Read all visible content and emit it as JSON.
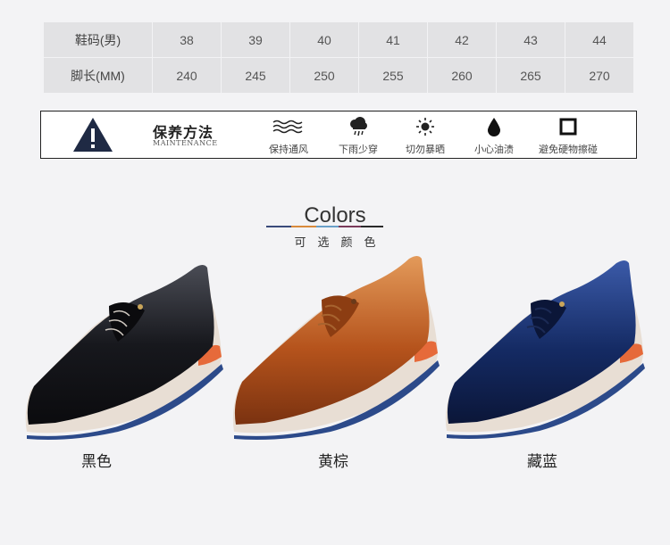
{
  "size_table": {
    "rows": [
      {
        "label": "鞋码(男)",
        "values": [
          "38",
          "39",
          "40",
          "41",
          "42",
          "43",
          "44"
        ]
      },
      {
        "label": "脚长(MM)",
        "values": [
          "240",
          "245",
          "250",
          "255",
          "260",
          "265",
          "270"
        ]
      }
    ]
  },
  "maintenance": {
    "title": "保养方法",
    "subtitle": "MAINTENANCE",
    "items": [
      {
        "icon": "wind-icon",
        "label": "保持通风"
      },
      {
        "icon": "rain-cloud-icon",
        "label": "下雨少穿"
      },
      {
        "icon": "sun-icon",
        "label": "切勿暴晒"
      },
      {
        "icon": "oil-drop-icon",
        "label": "小心油渍"
      },
      {
        "icon": "square-icon",
        "label": "避免硬物擦碰"
      }
    ]
  },
  "colors": {
    "title": "Colors",
    "subtitle": "可选颜色",
    "line_colors": [
      "#3a4a7a",
      "#d88a3c",
      "#6aa0c8",
      "#7a3a5a",
      "#2a2a2a"
    ]
  },
  "shoes": [
    {
      "label": "黑色",
      "upper": "#17181d",
      "highlight": "#4a4c55"
    },
    {
      "label": "黄棕",
      "upper": "#b5531c",
      "highlight": "#e08a4a"
    },
    {
      "label": "藏蓝",
      "upper": "#142a63",
      "highlight": "#3b5aa8"
    }
  ]
}
